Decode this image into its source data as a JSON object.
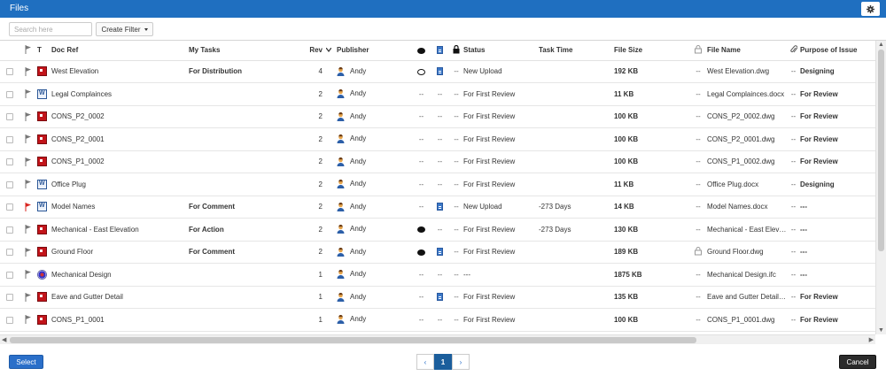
{
  "window": {
    "title": "Files"
  },
  "toolbar": {
    "search_placeholder": "Search here",
    "create_filter_label": "Create Filter"
  },
  "columns": {
    "type": "T",
    "doc_ref": "Doc Ref",
    "my_tasks": "My Tasks",
    "rev": "Rev",
    "publisher": "Publisher",
    "status": "Status",
    "task_time": "Task Time",
    "file_size": "File Size",
    "file_name": "File Name",
    "purpose": "Purpose of Issue"
  },
  "rows": [
    {
      "file_type": "dwg",
      "flag": "gray",
      "doc_ref": "West Elevation",
      "my_tasks": "For Distribution",
      "rev": "4",
      "publisher": "Andy",
      "comment": "outline",
      "doc": "doc",
      "lock": "--",
      "status": "New Upload",
      "task_time": "",
      "file_size": "192 KB",
      "checkout": "--",
      "file_name": "West Elevation.dwg",
      "attach": "--",
      "purpose": "Designing"
    },
    {
      "file_type": "docx",
      "flag": "gray",
      "doc_ref": "Legal Complainces",
      "my_tasks": "",
      "rev": "2",
      "publisher": "Andy",
      "comment": "--",
      "doc": "--",
      "lock": "--",
      "status": "For First Review",
      "task_time": "",
      "file_size": "11 KB",
      "checkout": "--",
      "file_name": "Legal Complainces.docx",
      "attach": "--",
      "purpose": "For Review"
    },
    {
      "file_type": "dwg",
      "flag": "gray",
      "doc_ref": "CONS_P2_0002",
      "my_tasks": "",
      "rev": "2",
      "publisher": "Andy",
      "comment": "--",
      "doc": "--",
      "lock": "--",
      "status": "For First Review",
      "task_time": "",
      "file_size": "100 KB",
      "checkout": "--",
      "file_name": "CONS_P2_0002.dwg",
      "attach": "--",
      "purpose": "For Review"
    },
    {
      "file_type": "dwg",
      "flag": "gray",
      "doc_ref": "CONS_P2_0001",
      "my_tasks": "",
      "rev": "2",
      "publisher": "Andy",
      "comment": "--",
      "doc": "--",
      "lock": "--",
      "status": "For First Review",
      "task_time": "",
      "file_size": "100 KB",
      "checkout": "--",
      "file_name": "CONS_P2_0001.dwg",
      "attach": "--",
      "purpose": "For Review"
    },
    {
      "file_type": "dwg",
      "flag": "gray",
      "doc_ref": "CONS_P1_0002",
      "my_tasks": "",
      "rev": "2",
      "publisher": "Andy",
      "comment": "--",
      "doc": "--",
      "lock": "--",
      "status": "For First Review",
      "task_time": "",
      "file_size": "100 KB",
      "checkout": "--",
      "file_name": "CONS_P1_0002.dwg",
      "attach": "--",
      "purpose": "For Review"
    },
    {
      "file_type": "docx",
      "flag": "gray",
      "doc_ref": "Office Plug",
      "my_tasks": "",
      "rev": "2",
      "publisher": "Andy",
      "comment": "--",
      "doc": "--",
      "lock": "--",
      "status": "For First Review",
      "task_time": "",
      "file_size": "11 KB",
      "checkout": "--",
      "file_name": "Office Plug.docx",
      "attach": "--",
      "purpose": "Designing"
    },
    {
      "file_type": "docx",
      "flag": "red",
      "doc_ref": "Model Names",
      "my_tasks": "For Comment",
      "rev": "2",
      "publisher": "Andy",
      "comment": "--",
      "doc": "doc",
      "lock": "--",
      "status": "New Upload",
      "task_time": "-273 Days",
      "file_size": "14 KB",
      "checkout": "--",
      "file_name": "Model Names.docx",
      "attach": "--",
      "purpose": "---"
    },
    {
      "file_type": "dwg",
      "flag": "gray",
      "doc_ref": "Mechanical - East Elevation",
      "my_tasks": "For Action",
      "rev": "2",
      "publisher": "Andy",
      "comment": "filled",
      "doc": "--",
      "lock": "--",
      "status": "For First Review",
      "task_time": "-273 Days",
      "file_size": "130 KB",
      "checkout": "--",
      "file_name": "Mechanical - East Elevation.dwg",
      "attach": "--",
      "purpose": "---"
    },
    {
      "file_type": "dwg",
      "flag": "gray",
      "doc_ref": "Ground Floor",
      "my_tasks": "For Comment",
      "rev": "2",
      "publisher": "Andy",
      "comment": "filled",
      "doc": "doc",
      "lock": "--",
      "status": "For First Review",
      "task_time": "",
      "file_size": "189 KB",
      "checkout": "icon",
      "file_name": "Ground Floor.dwg",
      "attach": "--",
      "purpose": "---"
    },
    {
      "file_type": "ifc",
      "flag": "gray",
      "doc_ref": "Mechanical Design",
      "my_tasks": "",
      "rev": "1",
      "publisher": "Andy",
      "comment": "--",
      "doc": "--",
      "lock": "--",
      "status": "---",
      "task_time": "",
      "file_size": "1875 KB",
      "checkout": "--",
      "file_name": "Mechanical Design.ifc",
      "attach": "--",
      "purpose": "---"
    },
    {
      "file_type": "dwg",
      "flag": "gray",
      "doc_ref": "Eave and Gutter Detail",
      "my_tasks": "",
      "rev": "1",
      "publisher": "Andy",
      "comment": "--",
      "doc": "doc",
      "lock": "--",
      "status": "For First Review",
      "task_time": "",
      "file_size": "135 KB",
      "checkout": "--",
      "file_name": "Eave and Gutter Detail.dwg",
      "attach": "--",
      "purpose": "For Review"
    },
    {
      "file_type": "dwg",
      "flag": "gray",
      "doc_ref": "CONS_P1_0001",
      "my_tasks": "",
      "rev": "1",
      "publisher": "Andy",
      "comment": "--",
      "doc": "--",
      "lock": "--",
      "status": "For First Review",
      "task_time": "",
      "file_size": "100 KB",
      "checkout": "--",
      "file_name": "CONS_P1_0001.dwg",
      "attach": "--",
      "purpose": "For Review"
    }
  ],
  "pagination": {
    "prev": "‹",
    "current": "1",
    "next": "›"
  },
  "footer": {
    "select_label": "Select",
    "cancel_label": "Cancel"
  },
  "colors": {
    "header_bar": "#1f6fc0",
    "primary_button": "#2a6fc9",
    "cancel_button": "#2b2b2b",
    "flag_red": "#d9241f"
  }
}
